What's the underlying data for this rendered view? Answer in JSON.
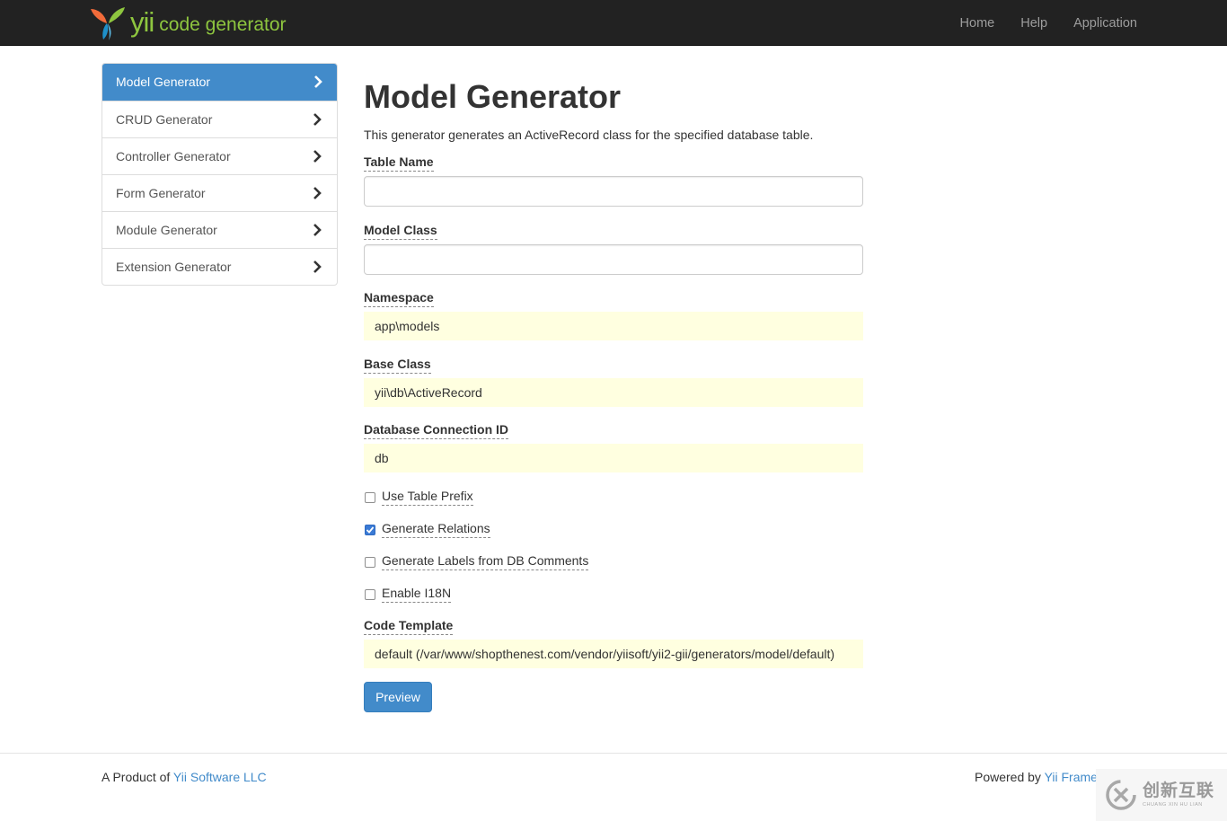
{
  "navbar": {
    "brand_yii": "yii",
    "brand_text": "code generator",
    "links": [
      "Home",
      "Help",
      "Application"
    ]
  },
  "sidebar": {
    "items": [
      {
        "label": "Model Generator",
        "active": true
      },
      {
        "label": "CRUD Generator",
        "active": false
      },
      {
        "label": "Controller Generator",
        "active": false
      },
      {
        "label": "Form Generator",
        "active": false
      },
      {
        "label": "Module Generator",
        "active": false
      },
      {
        "label": "Extension Generator",
        "active": false
      }
    ]
  },
  "main": {
    "title": "Model Generator",
    "description": "This generator generates an ActiveRecord class for the specified database table.",
    "fields": {
      "table_name": {
        "label": "Table Name",
        "value": ""
      },
      "model_class": {
        "label": "Model Class",
        "value": ""
      },
      "namespace": {
        "label": "Namespace",
        "value": "app\\models"
      },
      "base_class": {
        "label": "Base Class",
        "value": "yii\\db\\ActiveRecord"
      },
      "db_connection": {
        "label": "Database Connection ID",
        "value": "db"
      },
      "code_template": {
        "label": "Code Template",
        "value": "default (/var/www/shopthenest.com/vendor/yiisoft/yii2-gii/generators/model/default)"
      }
    },
    "checkboxes": [
      {
        "label": "Use Table Prefix",
        "checked": false
      },
      {
        "label": "Generate Relations",
        "checked": true
      },
      {
        "label": "Generate Labels from DB Comments",
        "checked": false
      },
      {
        "label": "Enable I18N",
        "checked": false
      }
    ],
    "preview_button": "Preview"
  },
  "footer": {
    "left_prefix": "A Product of",
    "left_link": "Yii Software LLC",
    "right_prefix": "Powered by",
    "right_link": "Yii Frame"
  },
  "watermark": {
    "cn": "创新互联",
    "en": "CHUANG XIN HU LIAN"
  },
  "colors": {
    "accent": "#428bca",
    "navbar_bg": "#222222",
    "sticky_bg": "#ffffe0",
    "brand_green": "#8ec63f"
  },
  "icons": {
    "brand": "yii-logo-icon",
    "chevron": "chevron-right-icon",
    "watermark": "watermark-logo-icon"
  }
}
